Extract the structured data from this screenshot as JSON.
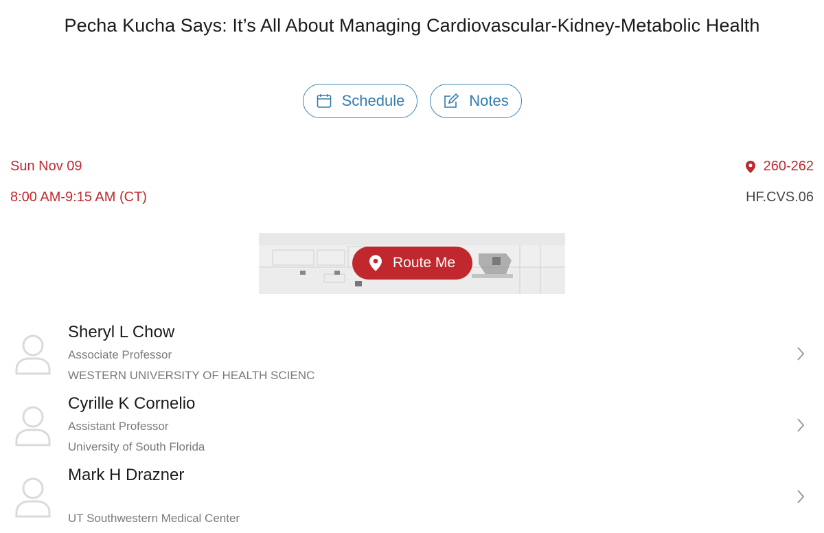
{
  "session": {
    "title": "Pecha Kucha Says: It’s All About Managing Cardiovascular-Kidney-Metabolic Health",
    "date": "Sun Nov 09",
    "time": "8:00 AM-9:15 AM (CT)",
    "room": "260-262",
    "code": "HF.CVS.06"
  },
  "actions": {
    "schedule_label": "Schedule",
    "notes_label": "Notes"
  },
  "map": {
    "route_label": "Route Me"
  },
  "speakers": [
    {
      "name": "Sheryl L Chow",
      "title": "Associate Professor",
      "org": "WESTERN UNIVERSITY OF HEALTH SCIENC"
    },
    {
      "name": "Cyrille K Cornelio",
      "title": "Assistant Professor",
      "org": "University of South Florida"
    },
    {
      "name": "Mark H Drazner",
      "title": "",
      "org": "UT Southwestern Medical Center"
    }
  ],
  "colors": {
    "accent_blue": "#2f7cb0",
    "accent_red": "#c0282d"
  }
}
